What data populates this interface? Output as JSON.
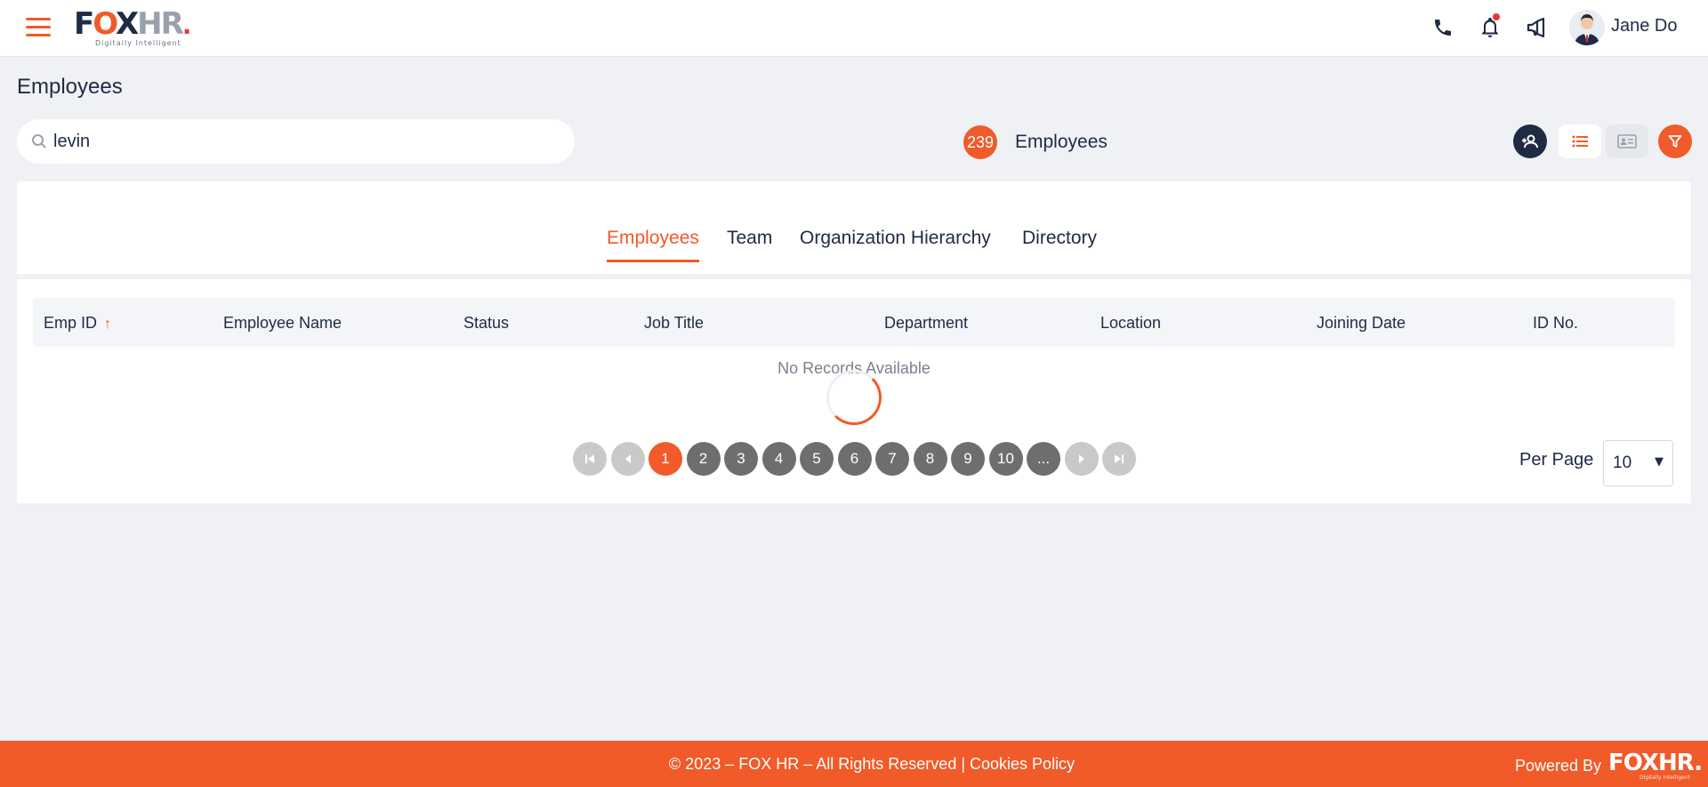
{
  "header": {
    "logo_text_a": "F",
    "logo_text_o": "O",
    "logo_text_b": "X",
    "logo_text_hr": "HR",
    "logo_tagline": "Digitally Intelligent",
    "user_name": "Jane Do"
  },
  "page": {
    "title": "Employees"
  },
  "search": {
    "value": "levin",
    "placeholder": "Search"
  },
  "summary": {
    "count": "239",
    "label": "Employees"
  },
  "tabs": [
    {
      "label": "Employees",
      "active": true
    },
    {
      "label": "Team",
      "active": false
    },
    {
      "label": "Organization Hierarchy",
      "active": false
    },
    {
      "label": "Directory",
      "active": false
    }
  ],
  "table": {
    "columns": [
      "Emp ID",
      "Employee Name",
      "Status",
      "Job Title",
      "Department",
      "Location",
      "Joining Date",
      "ID No."
    ],
    "sort_arrow": "↑",
    "empty_text": "No Records Available"
  },
  "pagination": {
    "pages": [
      "1",
      "2",
      "3",
      "4",
      "5",
      "6",
      "7",
      "8",
      "9",
      "10",
      "..."
    ],
    "current": "1",
    "per_page_label": "Per Page",
    "per_page_value": "10",
    "caret": "▼"
  },
  "footer": {
    "copyright": "© 2023 – FOX HR – All Rights Reserved | ",
    "cookies": "Cookies Policy",
    "powered_by": "Powered By",
    "logo": "FOXHR.",
    "tagline": "Digitally Intelligent"
  },
  "colors": {
    "accent": "#f15a29",
    "navy": "#1f2a44",
    "page_bg": "#eff1f5"
  }
}
